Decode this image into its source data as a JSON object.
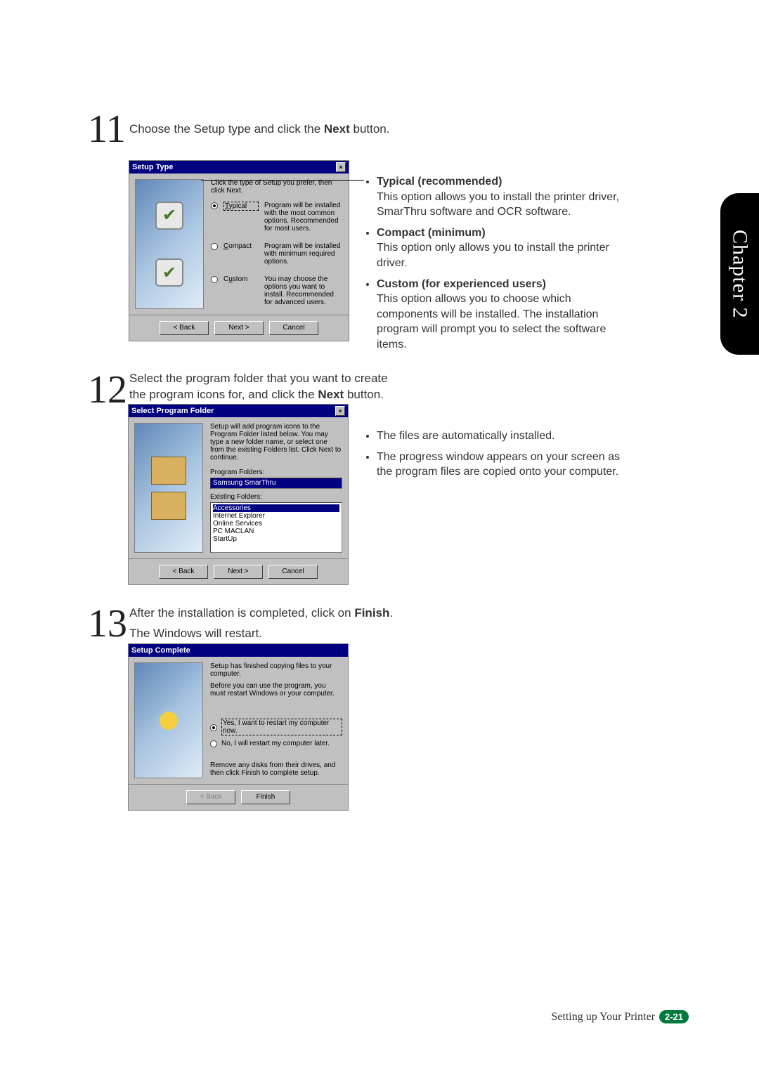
{
  "tab": {
    "label": "Chapter 2"
  },
  "footer": {
    "section": "Setting up Your Printer",
    "page": "2-21"
  },
  "step11": {
    "number": "11",
    "text_prefix": "Choose the Setup type and click the ",
    "text_bold": "Next",
    "text_suffix": " button."
  },
  "step12": {
    "number": "12",
    "line1": "Select the program folder that you want to create",
    "line2_prefix": "the program icons for, and click the ",
    "line2_bold": "Next",
    "line2_suffix": " button."
  },
  "step13": {
    "number": "13",
    "line1_prefix": "After the installation is completed, click on ",
    "line1_bold": "Finish",
    "line1_suffix": ".",
    "line2": "The Windows will restart."
  },
  "side1": {
    "items": [
      {
        "title": "Typical (recommended)",
        "desc": "This option allows you to install the printer driver, SmarThru software and OCR software."
      },
      {
        "title": "Compact (minimum)",
        "desc": "This option only allows you to install the printer driver."
      },
      {
        "title": "Custom (for experienced users)",
        "desc": "This option allows you to choose which components will be installed. The installation program will prompt you to select the software items."
      }
    ]
  },
  "side2": {
    "items": [
      "The files are automatically installed.",
      "The progress window appears on your screen as the program files are copied onto your computer."
    ]
  },
  "dlg1": {
    "title": "Setup Type",
    "instruction": "Click the type of Setup you prefer, then click Next.",
    "options": [
      {
        "label": "Typical",
        "desc": "Program will be installed with the most common options. Recommended for most users.",
        "selected": true
      },
      {
        "label": "Compact",
        "desc": "Program will be installed with minimum required options.",
        "selected": false
      },
      {
        "label": "Custom",
        "desc": "You may choose the options you want to install. Recommended for advanced users.",
        "selected": false
      }
    ],
    "buttons": {
      "back": "< Back",
      "next": "Next >",
      "cancel": "Cancel"
    }
  },
  "dlg2": {
    "title": "Select Program Folder",
    "instruction": "Setup will add program icons to the Program Folder listed below. You may type a new folder name, or select one from the existing Folders list. Click Next to continue.",
    "prog_folders_label": "Program Folders:",
    "prog_folders_value": "Samsung SmarThru",
    "existing_label": "Existing Folders:",
    "existing": [
      "Accessories",
      "Internet Explorer",
      "Online Services",
      "PC MACLAN",
      "StartUp"
    ],
    "buttons": {
      "back": "< Back",
      "next": "Next >",
      "cancel": "Cancel"
    }
  },
  "dlg3": {
    "title": "Setup Complete",
    "line1": "Setup has finished copying files to your computer.",
    "line2": "Before you can use the program, you must restart Windows or your computer.",
    "opt1": "Yes, I want to restart my computer now.",
    "opt2": "No, I will restart my computer later.",
    "line3": "Remove any disks from their drives, and then click Finish to complete setup.",
    "buttons": {
      "back": "< Back",
      "finish": "Finish"
    }
  }
}
